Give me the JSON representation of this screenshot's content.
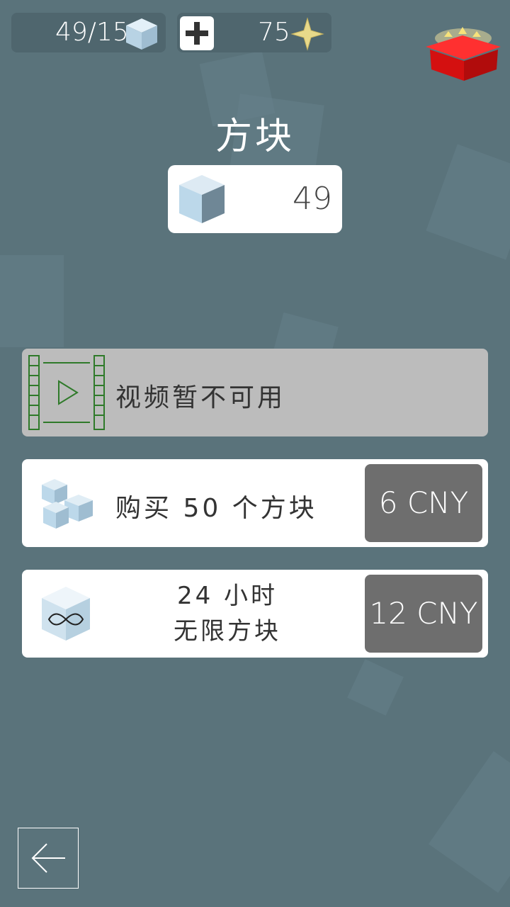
{
  "header": {
    "cube_counter": "49/15",
    "stars": "75"
  },
  "title": "方块",
  "cube_count": "49",
  "offers": {
    "video": {
      "label": "视频暂不可用"
    },
    "buy_cubes": {
      "label": "购买 50 个方块",
      "price": "6 CNY"
    },
    "unlimited": {
      "line1": "24 小时",
      "line2": "无限方块",
      "price": "12 CNY"
    }
  },
  "colors": {
    "background": "#5a737b",
    "cube": "#bcd8ea",
    "price_button": "#6e6e6e",
    "video_film": "#2f7a2a",
    "gift": "#e21b1b"
  },
  "icons": [
    "cube-icon",
    "plus-icon",
    "star-icon",
    "gift-box-icon",
    "film-play-icon",
    "cubes-stack-icon",
    "infinity-cube-icon",
    "back-arrow-icon"
  ]
}
